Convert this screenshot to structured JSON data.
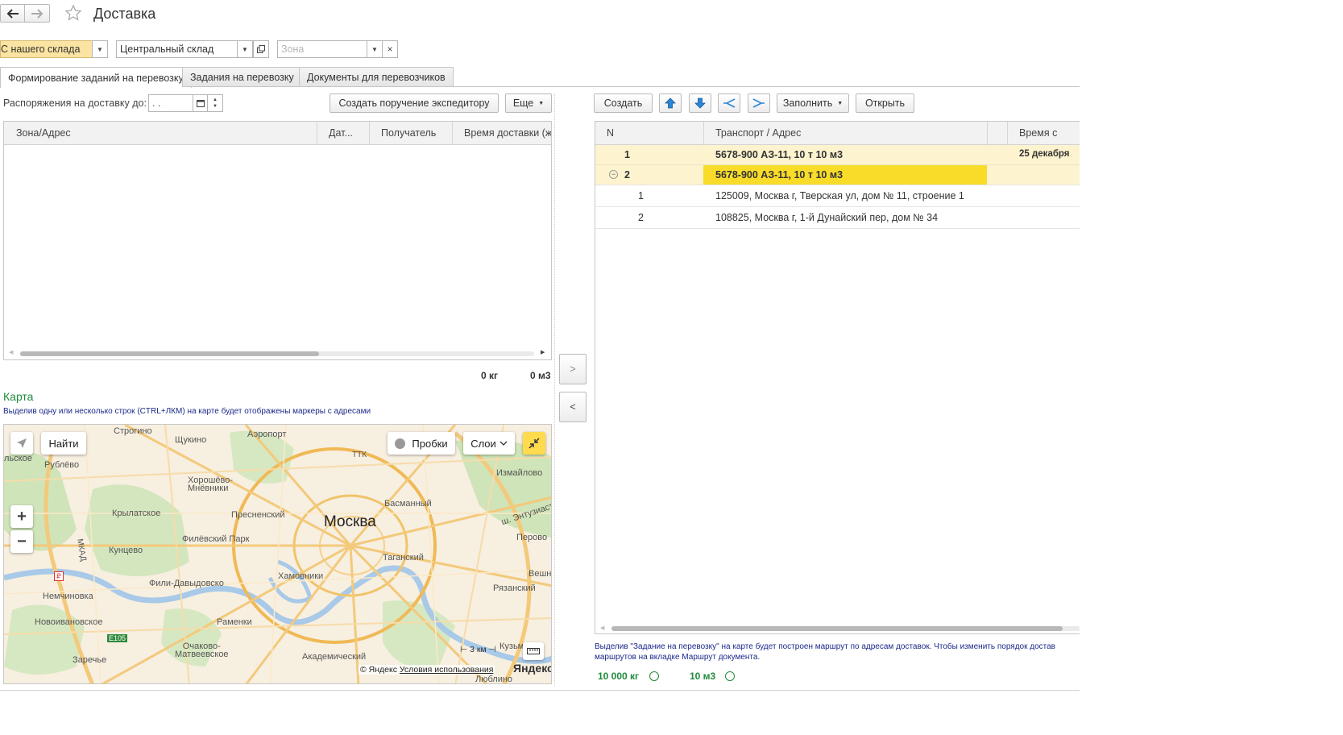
{
  "window": {
    "title": "Доставка"
  },
  "filters": {
    "source": "С нашего склада",
    "warehouse": "Центральный склад",
    "zone_placeholder": "Зона"
  },
  "tabs": [
    {
      "label": "Формирование заданий на перевозку"
    },
    {
      "label": "Задания на перевозку"
    },
    {
      "label": "Документы для перевозчиков"
    }
  ],
  "left": {
    "orders_label": "Распоряжения на доставку до:",
    "date_value": " .  .",
    "create_courier_btn": "Создать поручение экспедитору",
    "more_btn": "Еще",
    "columns": [
      "Зона/Адрес",
      "Дат...",
      "Получатель",
      "Время доставки (ж"
    ],
    "total_weight": "0 кг",
    "total_volume": "0 м3"
  },
  "transfer": {
    "right_btn": ">",
    "left_btn": "<"
  },
  "map": {
    "title": "Карта",
    "hint": "Выделив одну или несколько строк (CTRL+ЛКМ) на карте будет отображены маркеры с адресами",
    "find_btn": "Найти",
    "traffic_btn": "Пробки",
    "layers_btn": "Слои",
    "scale": "3 км",
    "copyright": "© Яндекс",
    "terms_link": "Условия использования",
    "brand": "Яндекс",
    "labels": [
      "Москва",
      "Строгино",
      "Щукино",
      "Аэропорт",
      "Измайлово",
      "Рублёво",
      "Хорошёво-\nМнёвники",
      "Крылатское",
      "Пресненский",
      "Басманный",
      "Филёвский Парк",
      "Кунцево",
      "Перово",
      "Таганский",
      "Хамовники",
      "Фили-Давыдовско",
      "Немчиновка",
      "Рязанский",
      "Новоивановское",
      "Раменки",
      "Очаково-\nМатвеевское",
      "Заречье",
      "Академический",
      "Кузьми",
      "Люблино",
      "ш. Энтузиаст",
      "Вешн",
      "льское",
      "ТТК",
      "МКАД",
      "E105"
    ]
  },
  "right": {
    "create_btn": "Создать",
    "fill_btn": "Заполнить",
    "open_btn": "Открыть",
    "columns": [
      "N",
      "Транспорт / Адрес",
      "Время с"
    ],
    "rows": [
      {
        "n": "1",
        "text": "5678-900 АЗ-11, 10 т 10 м3",
        "time": "25 декабря"
      },
      {
        "n": "2",
        "text": "5678-900 АЗ-11, 10 т 10 м3",
        "time": ""
      },
      {
        "n": "1",
        "text": "125009, Москва г, Тверская ул, дом № 11, строение 1",
        "time": ""
      },
      {
        "n": "2",
        "text": "108825, Москва г, 1-й Дунайский пер, дом № 34",
        "time": ""
      }
    ],
    "hint": "Выделив \"Задание на перевозку\" на карте будет построен маршрут по адресам доставок. Чтобы изменить порядок достав\nмаршрутов на вкладке Маршрут документа.",
    "total_weight": "10 000 кг",
    "total_volume": "10 м3"
  },
  "colors": {
    "accent_yellow": "#fbe3a1",
    "selected_row": "#f9dc29",
    "group_row": "#fdf3cf",
    "green_text": "#1f8a3b",
    "hint_blue": "#1b2a8a"
  }
}
